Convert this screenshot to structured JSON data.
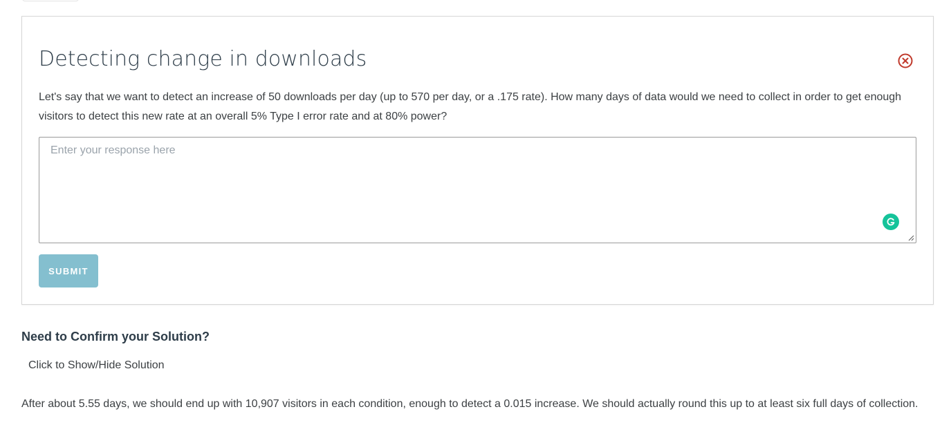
{
  "quiz": {
    "title": "Detecting change in downloads",
    "prompt": "Let's say that we want to detect an increase of 50 downloads per day (up to 570 per day, or a .175 rate). How many days of data would we need to collect in order to get enough visitors to detect this new rate at an overall 5% Type I error rate and at 80% power?",
    "response_placeholder": "Enter your response here",
    "response_value": "",
    "submit_label": "SUBMIT",
    "icons": {
      "close": "close-circle-icon",
      "grammarly": "grammarly-icon",
      "resize": "resize-handle-icon"
    }
  },
  "solution_section": {
    "heading": "Need to Confirm your Solution?",
    "toggle_label": "Click to Show/Hide Solution",
    "solution_text": "After about 5.55 days, we should end up with 10,907 visitors in each condition, enough to detect a 0.015 increase. We should actually round this up to at least six full days of collection."
  },
  "colors": {
    "close_icon": "#c0392b",
    "submit_button_bg": "#84bfcf",
    "grammarly_badge": "#15c39a",
    "title_text": "#2e3d49"
  }
}
